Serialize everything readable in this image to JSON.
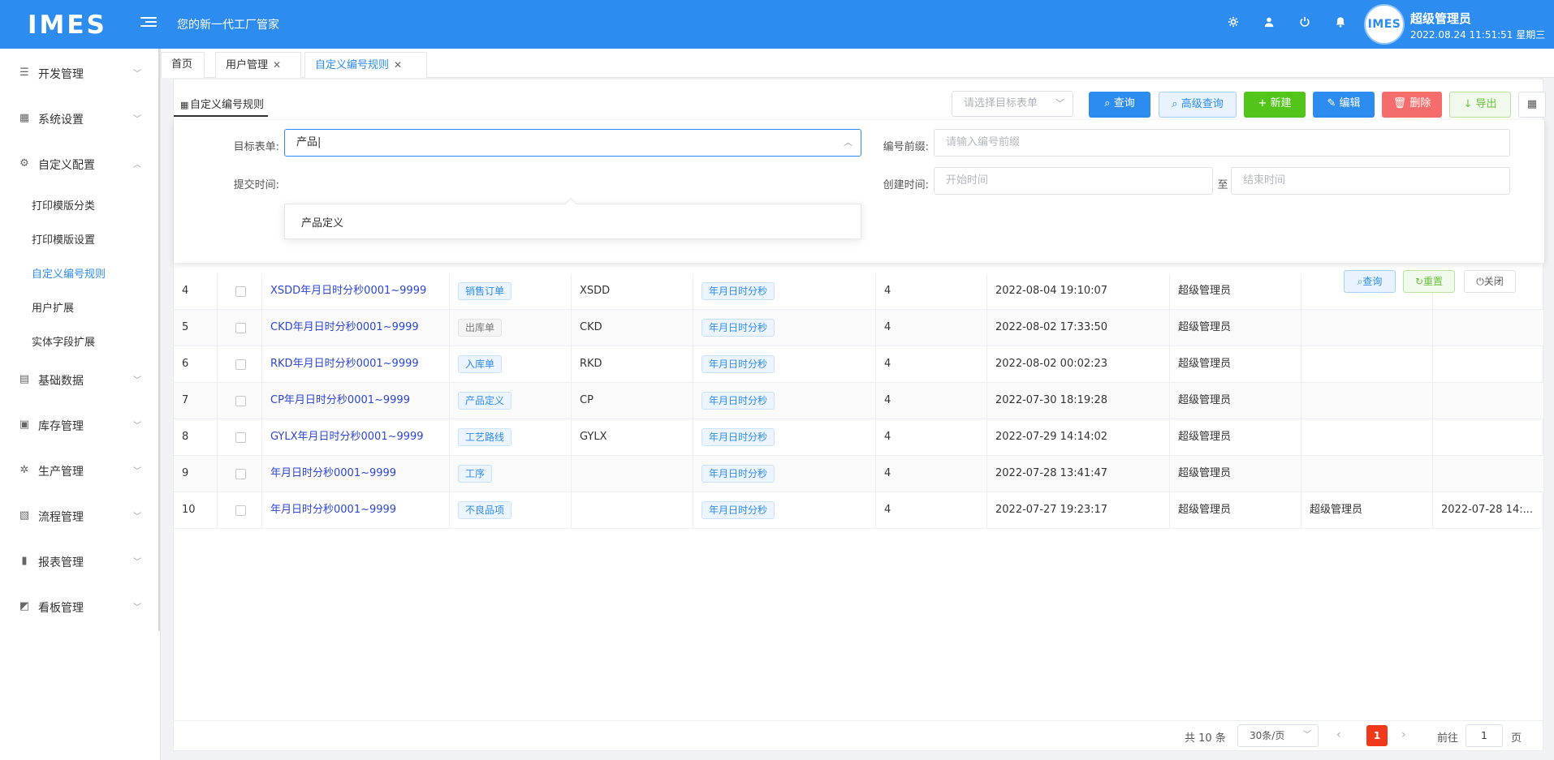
{
  "header": {
    "logo": "IMES",
    "tagline": "您的新一代工厂管家",
    "avatar_text": "IMES",
    "user_name": "超级管理员",
    "datetime": "2022.08.24 11:51:51 星期三",
    "accent": "#2d8cf0"
  },
  "sidebar": {
    "menu": [
      {
        "label": "开发管理",
        "icon": "sliders-icon"
      },
      {
        "label": "系统设置",
        "icon": "grid-icon"
      },
      {
        "label": "自定义配置",
        "icon": "gear-icon"
      },
      {
        "label": "基础数据",
        "icon": "book-icon"
      },
      {
        "label": "库存管理",
        "icon": "clipboard-icon"
      },
      {
        "label": "生产管理",
        "icon": "cog-icon"
      },
      {
        "label": "流程管理",
        "icon": "flow-icon"
      },
      {
        "label": "报表管理",
        "icon": "bar-chart-icon"
      },
      {
        "label": "看板管理",
        "icon": "line-chart-icon"
      }
    ],
    "sub_items": [
      "打印模版分类",
      "打印模版设置",
      "自定义编号规则",
      "用户扩展",
      "实体字段扩展"
    ],
    "active_sub": "自定义编号规则"
  },
  "tabs": [
    {
      "label": "首页"
    },
    {
      "label": "用户管理"
    },
    {
      "label": "自定义编号规则"
    }
  ],
  "panel": {
    "title": "自定义编号规则",
    "select_placeholder": "请选择目标表单",
    "buttons": {
      "query": "查询",
      "advanced": "高级查询",
      "new": "新建",
      "edit": "编辑",
      "delete": "删除",
      "export": "导出"
    }
  },
  "search": {
    "target_label": "目标表单:",
    "target_value": "产品",
    "prefix_label": "编号前缀:",
    "prefix_placeholder": "请输入编号前缀",
    "submit_label": "提交时间:",
    "create_label": "创建时间:",
    "start_placeholder": "开始时间",
    "to": "至",
    "end_placeholder": "结束时间",
    "dropdown_option": "产品定义",
    "btn_query": "查询",
    "btn_reset": "重置",
    "btn_close": "关闭"
  },
  "rows": [
    {
      "no": "4",
      "rule": "XSDD年月日时分秒0001~9999",
      "form": "销售订单",
      "form_style": "blue",
      "prefix": "XSDD",
      "date_fmt": "年月日时分秒",
      "digits": "4",
      "created": "2022-08-04 19:10:07",
      "creator": "超级管理员",
      "modifier": "",
      "modified": ""
    },
    {
      "no": "5",
      "rule": "CKD年月日时分秒0001~9999",
      "form": "出库单",
      "form_style": "gray",
      "prefix": "CKD",
      "date_fmt": "年月日时分秒",
      "digits": "4",
      "created": "2022-08-02 17:33:50",
      "creator": "超级管理员",
      "modifier": "",
      "modified": ""
    },
    {
      "no": "6",
      "rule": "RKD年月日时分秒0001~9999",
      "form": "入库单",
      "form_style": "blue",
      "prefix": "RKD",
      "date_fmt": "年月日时分秒",
      "digits": "4",
      "created": "2022-08-02 00:02:23",
      "creator": "超级管理员",
      "modifier": "",
      "modified": ""
    },
    {
      "no": "7",
      "rule": "CP年月日时分秒0001~9999",
      "form": "产品定义",
      "form_style": "blue",
      "prefix": "CP",
      "date_fmt": "年月日时分秒",
      "digits": "4",
      "created": "2022-07-30 18:19:28",
      "creator": "超级管理员",
      "modifier": "",
      "modified": ""
    },
    {
      "no": "8",
      "rule": "GYLX年月日时分秒0001~9999",
      "form": "工艺路线",
      "form_style": "blue",
      "prefix": "GYLX",
      "date_fmt": "年月日时分秒",
      "digits": "4",
      "created": "2022-07-29 14:14:02",
      "creator": "超级管理员",
      "modifier": "",
      "modified": ""
    },
    {
      "no": "9",
      "rule": "年月日时分秒0001~9999",
      "form": "工序",
      "form_style": "blue",
      "prefix": "",
      "date_fmt": "年月日时分秒",
      "digits": "4",
      "created": "2022-07-28 13:41:47",
      "creator": "超级管理员",
      "modifier": "",
      "modified": ""
    },
    {
      "no": "10",
      "rule": "年月日时分秒0001~9999",
      "form": "不良品项",
      "form_style": "blue",
      "prefix": "",
      "date_fmt": "年月日时分秒",
      "digits": "4",
      "created": "2022-07-27 19:23:17",
      "creator": "超级管理员",
      "modifier": "超级管理员",
      "modified": "2022-07-28 14:..."
    }
  ],
  "pager": {
    "total": "共 10 条",
    "page_size": "30条/页",
    "current": "1",
    "goto_label": "前往",
    "goto_value": "1",
    "page_unit": "页"
  }
}
